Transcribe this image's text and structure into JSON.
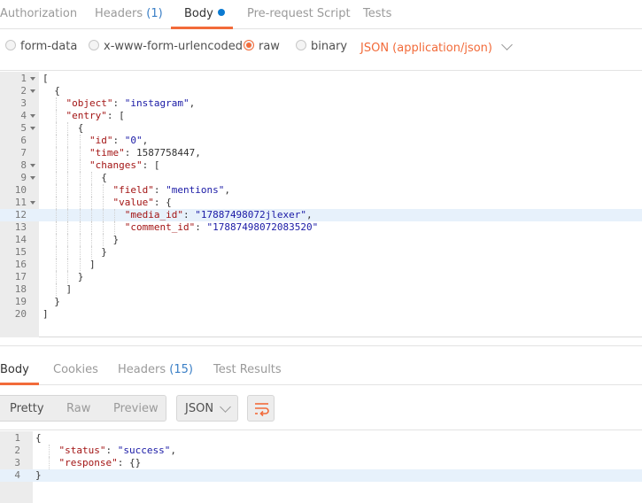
{
  "request_tabs": [
    {
      "label": "Authorization",
      "count": ""
    },
    {
      "label": "Headers",
      "count": "(1)"
    },
    {
      "label": "Body",
      "count": ""
    },
    {
      "label": "Pre-request Script",
      "count": ""
    },
    {
      "label": "Tests",
      "count": ""
    }
  ],
  "active_request_tab": "Body",
  "body_types": [
    "form-data",
    "x-www-form-urlencoded",
    "raw",
    "binary"
  ],
  "selected_body_type": "raw",
  "content_type": "JSON (application/json)",
  "request_body_lines": [
    "[",
    "  {",
    "    \"object\": \"instagram\",",
    "    \"entry\": [",
    "      {",
    "        \"id\": \"0\",",
    "        \"time\": 1587758447,",
    "        \"changes\": [",
    "          {",
    "            \"field\": \"mentions\",",
    "            \"value\": {",
    "              \"media_id\": \"17887498072jlexer\",",
    "              \"comment_id\": \"17887498072083520\"",
    "            }",
    "          }",
    "        ]",
    "      }",
    "    ]",
    "  }",
    "]"
  ],
  "request_line_numbers": [
    "1",
    "2",
    "3",
    "4",
    "5",
    "6",
    "7",
    "8",
    "9",
    "10",
    "11",
    "12",
    "13",
    "14",
    "15",
    "16",
    "17",
    "18",
    "19",
    "20"
  ],
  "request_active_line": "12",
  "response_tabs": [
    {
      "label": "Body",
      "count": ""
    },
    {
      "label": "Cookies",
      "count": ""
    },
    {
      "label": "Headers",
      "count": "(15)"
    },
    {
      "label": "Test Results",
      "count": ""
    }
  ],
  "active_response_tab": "Body",
  "response_views": [
    "Pretty",
    "Raw",
    "Preview"
  ],
  "active_response_view": "Pretty",
  "response_format": "JSON",
  "wrap_icon": "wrap-lines-icon",
  "response_body_lines": [
    "{",
    "    \"status\": \"success\",",
    "    \"response\": {}",
    "}"
  ],
  "response_line_numbers": [
    "1",
    "2",
    "3",
    "4"
  ],
  "response_active_line": "4",
  "colors": {
    "accent": "#f26b3a",
    "link_blue": "#3a7fc6",
    "body_dot": "#0b7ad1",
    "active_line_bg": "#e7f1fb"
  }
}
